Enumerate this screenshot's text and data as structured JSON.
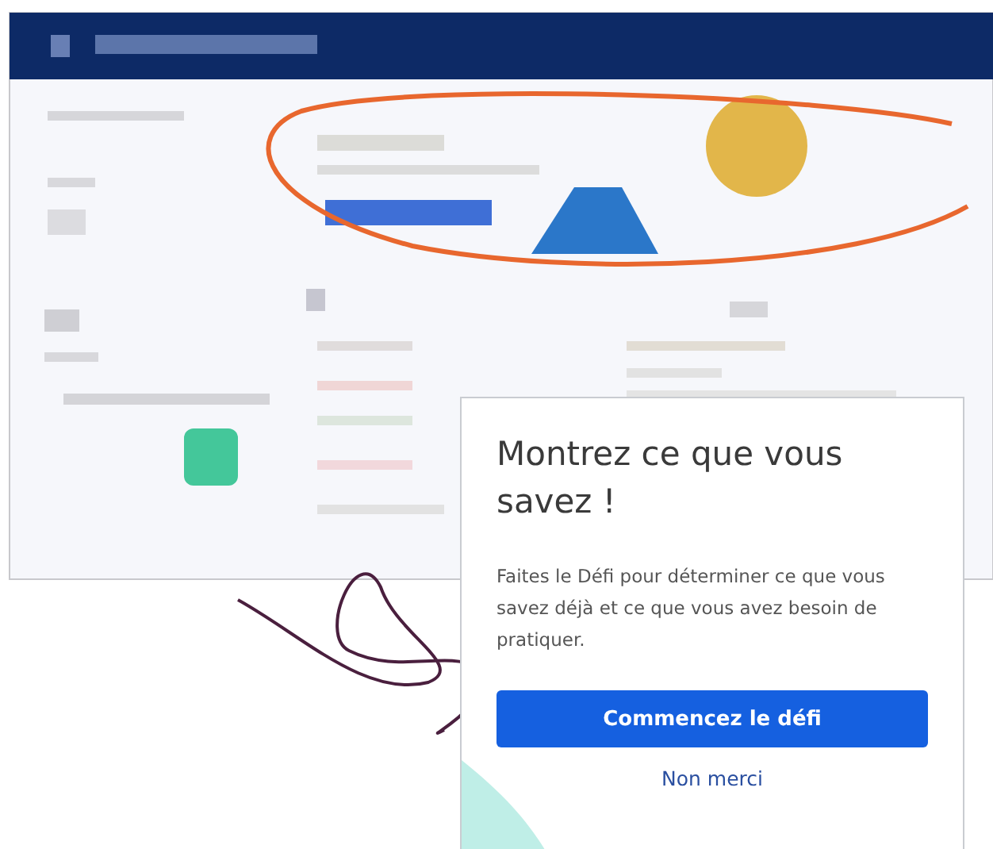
{
  "dialog": {
    "title": "Montrez ce que vous savez !",
    "body": "Faites le Défi pour déterminer ce que vous savez déjà et ce que vous avez besoin de pratiquer.",
    "primary_button": "Commencez le défi",
    "secondary_link": "Non merci"
  }
}
